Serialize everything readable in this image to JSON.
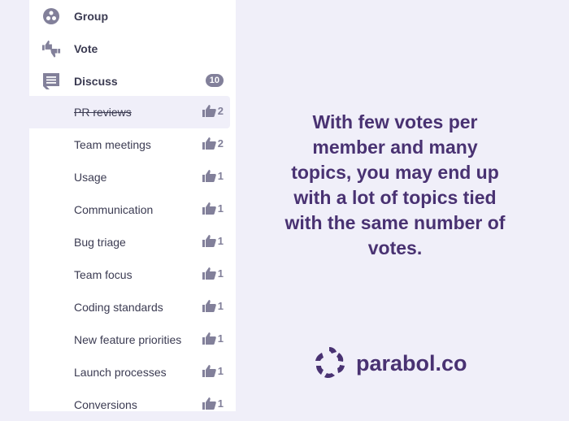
{
  "sidebar": {
    "phases": [
      {
        "label": "Group",
        "icon": "group-icon"
      },
      {
        "label": "Vote",
        "icon": "vote-icon"
      },
      {
        "label": "Discuss",
        "icon": "discuss-icon",
        "badge": "10"
      }
    ],
    "topics": [
      {
        "label": "PR reviews",
        "votes": "2",
        "active": true,
        "struck": true
      },
      {
        "label": "Team meetings",
        "votes": "2"
      },
      {
        "label": "Usage",
        "votes": "1"
      },
      {
        "label": "Communication",
        "votes": "1"
      },
      {
        "label": "Bug triage",
        "votes": "1"
      },
      {
        "label": "Team focus",
        "votes": "1"
      },
      {
        "label": "Coding standards",
        "votes": "1"
      },
      {
        "label": "New feature priorities",
        "votes": "1"
      },
      {
        "label": "Launch processes",
        "votes": "1"
      },
      {
        "label": "Conversions",
        "votes": "1"
      }
    ]
  },
  "main": {
    "message": "With few votes per member and many topics, you may end up with a lot of topics tied with the same number of votes.",
    "logo_text": "parabol.co"
  },
  "colors": {
    "brand": "#493272",
    "icon_gray": "#82809a",
    "background": "#f0eff9"
  }
}
